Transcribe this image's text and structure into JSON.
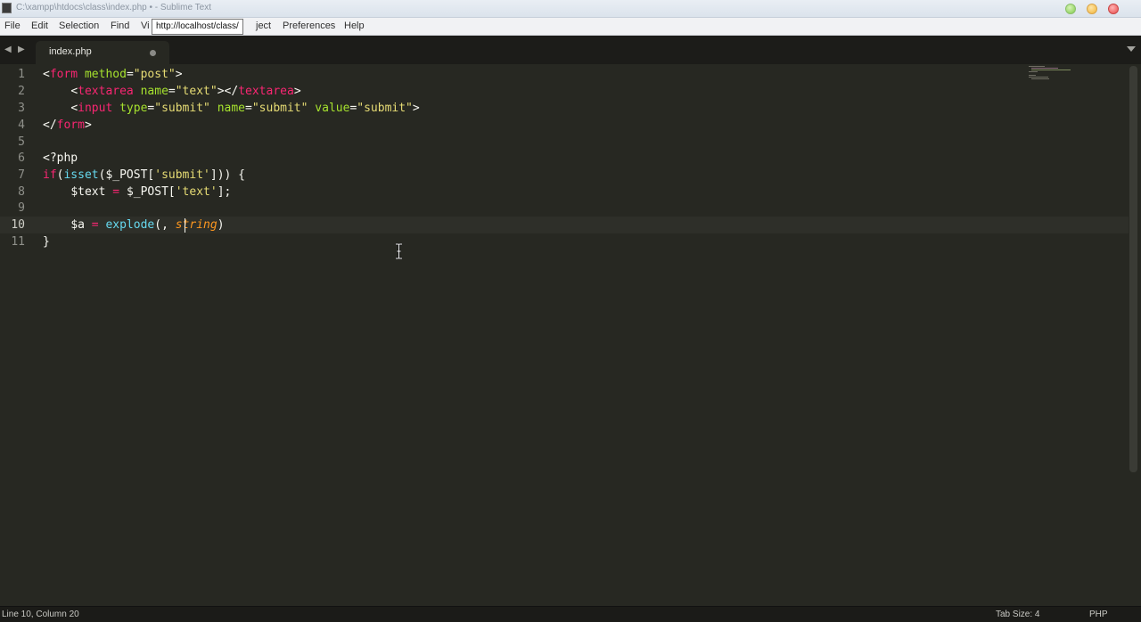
{
  "window": {
    "title": "C:\\xampp\\htdocs\\class\\index.php • - Sublime Text"
  },
  "menu": {
    "items": [
      "File",
      "Edit",
      "Selection",
      "Find",
      "Vi",
      "ject",
      "Preferences",
      "Help"
    ],
    "tooltip": "http://localhost/class/"
  },
  "tabs": [
    {
      "label": "index.php",
      "dirty": true
    }
  ],
  "editor": {
    "line_numbers": [
      "1",
      "2",
      "3",
      "4",
      "5",
      "6",
      "7",
      "8",
      "9",
      "10",
      "11"
    ],
    "active_line": 10,
    "lines": [
      "<form method=\"post\">",
      "    <textarea name=\"text\"></textarea>",
      "    <input type=\"submit\" name=\"submit\" value=\"submit\">",
      "</form>",
      "",
      "<?php",
      "if(isset($_POST['submit'])) {",
      "    $text = $_POST['text'];",
      "",
      "    $a = explode(, string)",
      "}"
    ]
  },
  "statusbar": {
    "position": "Line 10, Column 20",
    "tab_size": "Tab Size: 4",
    "syntax": "PHP"
  },
  "theme": {
    "editor_bg": "#272822",
    "tag_color": "#f92672",
    "attr_color": "#a6e22e",
    "string_color": "#e6db74",
    "function_color": "#66d9ef",
    "param_color": "#fd971f"
  }
}
